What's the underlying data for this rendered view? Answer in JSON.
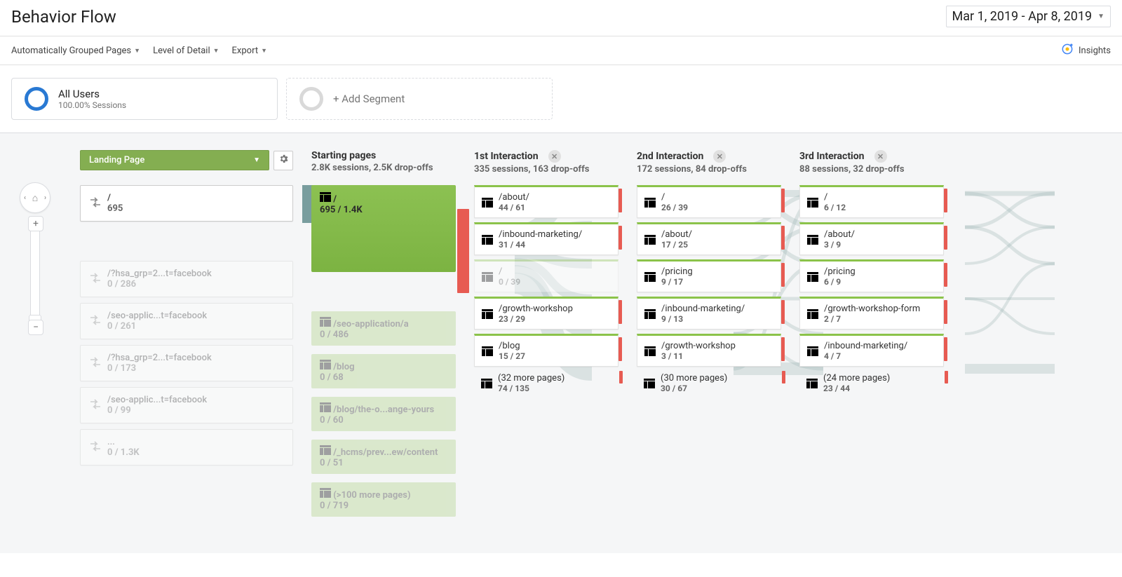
{
  "header": {
    "title": "Behavior Flow",
    "date_range": "Mar 1, 2019 - Apr 8, 2019"
  },
  "toolbar": {
    "grouped_pages": "Automatically Grouped Pages",
    "level_detail": "Level of Detail",
    "export": "Export",
    "insights": "Insights"
  },
  "segments": {
    "all_users": {
      "title": "All Users",
      "sub": "100.00% Sessions"
    },
    "add": {
      "label": "+ Add Segment"
    }
  },
  "flow": {
    "dimension_label": "Landing Page",
    "columns": [
      {
        "key": "dim",
        "nodes": [
          {
            "path": "/",
            "stats": "695",
            "active": true
          },
          {
            "path": "/?hsa_grp=2...t=facebook",
            "stats": "0 / 286",
            "active": false
          },
          {
            "path": "/seo-applic...t=facebook",
            "stats": "0 / 261",
            "active": false
          },
          {
            "path": "/?hsa_grp=2...t=facebook",
            "stats": "0 / 173",
            "active": false
          },
          {
            "path": "/seo-applic...t=facebook",
            "stats": "0 / 99",
            "active": false
          },
          {
            "path": "...",
            "stats": "0 / 1.3K",
            "active": false
          }
        ]
      },
      {
        "key": "start",
        "title": "Starting pages",
        "sub": "2.8K sessions, 2.5K drop-offs",
        "nodes": [
          {
            "path": "/",
            "stats": "695 / 1.4K",
            "big": true,
            "active": true
          },
          {
            "path": "/seo-application/a",
            "stats": "0 / 486",
            "big": true,
            "active": false
          },
          {
            "path": "/blog",
            "stats": "0 / 68",
            "big": true,
            "active": false
          },
          {
            "path": "/blog/the-o...ange-yours",
            "stats": "0 / 60",
            "big": true,
            "active": false
          },
          {
            "path": "/_hcms/prev...ew/content",
            "stats": "0 / 51",
            "big": true,
            "active": false
          },
          {
            "path": "(>100 more pages)",
            "stats": "0 / 719",
            "big": true,
            "active": false
          }
        ]
      },
      {
        "key": "int1",
        "title": "1st Interaction",
        "sub": "335 sessions, 163 drop-offs",
        "closable": true,
        "nodes": [
          {
            "path": "/about/",
            "stats": "44 / 61"
          },
          {
            "path": "/inbound-marketing/",
            "stats": "31 / 44"
          },
          {
            "path": "/",
            "stats": "0 / 39",
            "faded": true
          },
          {
            "path": "/growth-workshop",
            "stats": "23 / 29"
          },
          {
            "path": "/blog",
            "stats": "15 / 27"
          },
          {
            "path": "(32 more pages)",
            "stats": "74 / 135",
            "more": true
          }
        ]
      },
      {
        "key": "int2",
        "title": "2nd Interaction",
        "sub": "172 sessions, 84 drop-offs",
        "closable": true,
        "nodes": [
          {
            "path": "/",
            "stats": "26 / 39"
          },
          {
            "path": "/about/",
            "stats": "17 / 25"
          },
          {
            "path": "/pricing",
            "stats": "9 / 17"
          },
          {
            "path": "/inbound-marketing/",
            "stats": "9 / 13"
          },
          {
            "path": "/growth-workshop",
            "stats": "3 / 11"
          },
          {
            "path": "(30 more pages)",
            "stats": "30 / 67",
            "more": true
          }
        ]
      },
      {
        "key": "int3",
        "title": "3rd Interaction",
        "sub": "88 sessions, 32 drop-offs",
        "closable": true,
        "nodes": [
          {
            "path": "/",
            "stats": "6 / 12"
          },
          {
            "path": "/about/",
            "stats": "3 / 9"
          },
          {
            "path": "/pricing",
            "stats": "6 / 9"
          },
          {
            "path": "/growth-workshop-form",
            "stats": "2 / 7"
          },
          {
            "path": "/inbound-marketing/",
            "stats": "4 / 7"
          },
          {
            "path": "(24 more pages)",
            "stats": "23 / 44",
            "more": true
          }
        ]
      }
    ]
  }
}
